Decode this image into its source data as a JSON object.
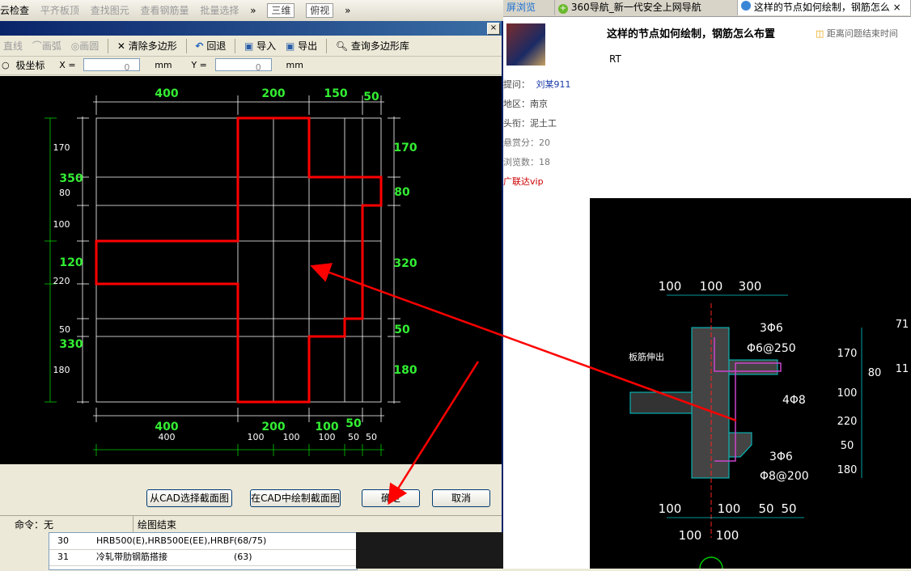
{
  "app_toolbar": {
    "items": [
      "云检查",
      "平齐板顶",
      "查找图元",
      "查看钢筋量",
      "批量选择"
    ],
    "more": "»",
    "view_select": "三维",
    "view_select2": "俯视",
    "more2": "»"
  },
  "dialog": {
    "close": "×",
    "toolbar": {
      "line": "直线",
      "arc": "画弧",
      "circle": "画圆",
      "clear_polygon": "清除多边形",
      "undo": "回退",
      "import": "导入",
      "export": "导出",
      "query_library": "查询多边形库"
    },
    "coords": {
      "polar": "极坐标",
      "x_label": "X =",
      "x_value": "0",
      "x_unit": "mm",
      "y_label": "Y =",
      "y_value": "0",
      "y_unit": "mm"
    },
    "buttons": {
      "select_from_cad": "从CAD选择截面图",
      "draw_in_cad": "在CAD中绘制截面图",
      "ok": "确定",
      "cancel": "取消"
    },
    "status": {
      "command": "命令：无",
      "message": "绘图结束"
    }
  },
  "drawing": {
    "top_dims": [
      "400",
      "200",
      "150",
      "50"
    ],
    "bottom_dims_green": [
      "400",
      "200",
      "100",
      "50"
    ],
    "bottom_dims_white": [
      "400",
      "100",
      "100",
      "100",
      "50",
      "50"
    ],
    "left_dims_white": [
      "170",
      "80",
      "100",
      "220",
      "50",
      "180"
    ],
    "left_dims_green": [
      "350",
      "120",
      "330"
    ],
    "right_dims": [
      "170",
      "80",
      "320",
      "50",
      "180"
    ]
  },
  "bg_table": {
    "rows": [
      {
        "no": "30",
        "name": "HRB500(E),HRB500E(EE),HRBF",
        "val": "(68/75)"
      },
      {
        "no": "31",
        "name": "冷轧带肋钢筋搭接",
        "val": "(63)"
      }
    ]
  },
  "browser": {
    "tabs": [
      "屏浏览",
      "360导航_新一代安全上网导航",
      "这样的节点如何绘制，钢筋怎么"
    ],
    "tab_close": "×",
    "question": {
      "title": "这样的节点如何绘制，钢筋怎么布置",
      "remaining": "距离问题结束时间",
      "body": "RT"
    },
    "meta": {
      "asker_label": "提问：",
      "asker_name": "刘某911",
      "region": "地区：南京",
      "title": "头衔：泥土工",
      "reward": "悬赏分：20",
      "views": "浏览数：18",
      "vip": "广联达vip"
    },
    "cad": {
      "top_dims": [
        "100",
        "100",
        "300"
      ],
      "bottom_dims": [
        "100",
        "100",
        "50",
        "50"
      ],
      "bottom_dims2": [
        "100",
        "100"
      ],
      "right_dims": [
        "170",
        "100",
        "220",
        "50",
        "180"
      ],
      "right_extra": [
        "80",
        "71",
        "11"
      ],
      "label_rebar1": "3Φ6",
      "label_rebar2": "Φ6@250",
      "label_rebar3": "4Φ8",
      "label_rebar4": "3Φ6",
      "label_rebar5": "Φ8@200",
      "label_slab": "板筋伸出"
    }
  },
  "colors": {
    "accent_red": "#ff0000",
    "dim_green": "#00cc00",
    "cad_cyan": "#00cccc",
    "cad_magenta": "#cc44cc"
  }
}
